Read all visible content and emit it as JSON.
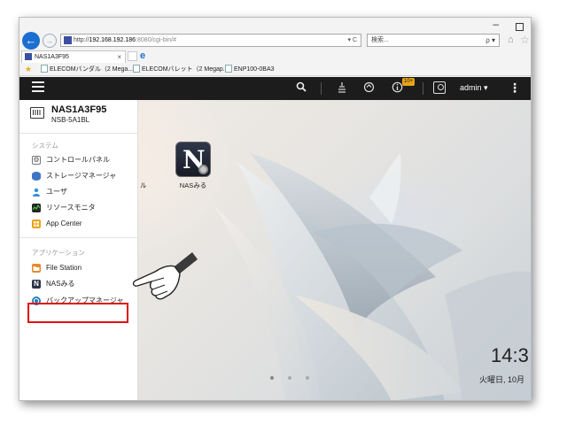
{
  "browser": {
    "url_prefix": "http://",
    "url_host": "192.168.192.186",
    "url_port_path": ":8080/cgi-bin/#",
    "url_controls": "▾ C",
    "search_placeholder": "検索...",
    "search_controls": "ρ ▾",
    "tab_title": "NAS1A3F95",
    "tab_close": "×",
    "favorites": [
      "ELECOMバンダル（2 Mega...",
      "ELECOMバレット（2 Megap...",
      "ENP100-0BA3"
    ]
  },
  "topbar": {
    "badge": "10+",
    "user": "admin ▾"
  },
  "sidebar": {
    "device_name": "NAS1A3F95",
    "device_model": "NSB-5A1BL",
    "section_system": "システム",
    "system_items": [
      {
        "label": "コントロールパネル",
        "icon": "gear-icon",
        "color": "#9a9a9a"
      },
      {
        "label": "ストレージマネージャ",
        "icon": "database-icon",
        "color": "#3d76c4"
      },
      {
        "label": "ユーザ",
        "icon": "user-icon",
        "color": "#2f8ed6"
      },
      {
        "label": "リソースモニタ",
        "icon": "monitor-icon",
        "color": "#2a3a2a"
      },
      {
        "label": "App Center",
        "icon": "app-center-icon",
        "color": "#e8a317"
      }
    ],
    "section_apps": "アプリケーション",
    "app_items": [
      {
        "label": "File Station",
        "icon": "folder-icon",
        "color": "#e98a2a"
      },
      {
        "label": "NASみる",
        "icon": "nasmiru-icon",
        "color": "#2b3347"
      },
      {
        "label": "バックアップマネージャ",
        "icon": "backup-icon",
        "color": "#1e7fb8"
      }
    ]
  },
  "desktop": {
    "app_label": "NASみる",
    "partial_label": "ル",
    "clock_time": "14:3",
    "clock_date": "火曜日, 10月"
  },
  "colors": {
    "topbar": "#1c1c1c",
    "highlight": "#e01010",
    "accent": "#1a6fd1"
  }
}
